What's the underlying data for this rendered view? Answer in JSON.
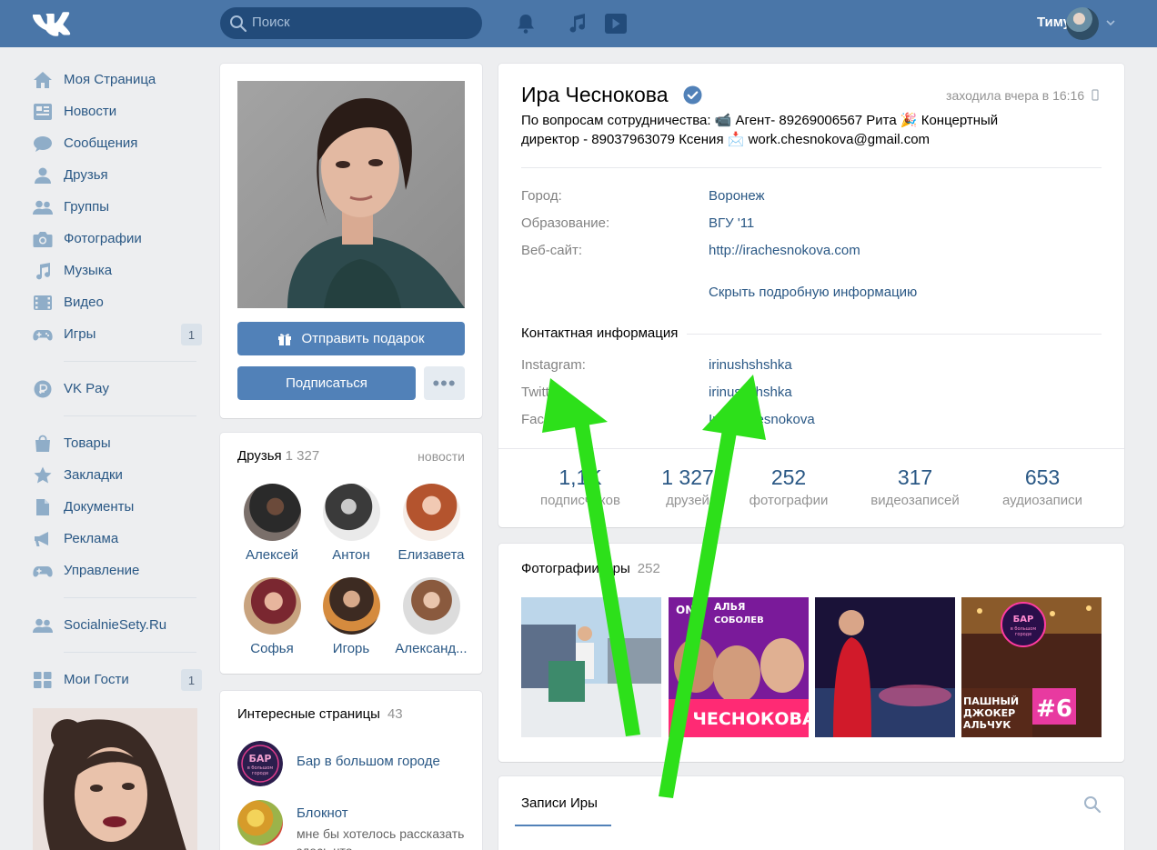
{
  "header": {
    "search_placeholder": "Поиск",
    "user_name": "Тимур",
    "colors": {
      "bar": "#4a76a8",
      "search_bg": "#224b7a",
      "link": "#2a5885",
      "button": "#5181b8",
      "arrow": "#2de01a"
    },
    "icons": [
      "vk-logo-icon",
      "search-icon",
      "bell-icon",
      "music-note-icon",
      "video-play-icon",
      "chevron-down-icon"
    ]
  },
  "nav": {
    "items": [
      {
        "label": "Моя Страница",
        "icon": "home-icon"
      },
      {
        "label": "Новости",
        "icon": "news-icon"
      },
      {
        "label": "Сообщения",
        "icon": "messages-icon"
      },
      {
        "label": "Друзья",
        "icon": "friend-icon"
      },
      {
        "label": "Группы",
        "icon": "groups-icon"
      },
      {
        "label": "Фотографии",
        "icon": "camera-icon"
      },
      {
        "label": "Музыка",
        "icon": "music-icon"
      },
      {
        "label": "Видео",
        "icon": "video-icon"
      },
      {
        "label": "Игры",
        "icon": "gamepad-icon",
        "count": "1"
      }
    ],
    "pay": {
      "label": "VK Pay",
      "icon": "vkpay-icon"
    },
    "items2": [
      {
        "label": "Товары",
        "icon": "bag-icon"
      },
      {
        "label": "Закладки",
        "icon": "star-icon"
      },
      {
        "label": "Документы",
        "icon": "document-icon"
      },
      {
        "label": "Реклама",
        "icon": "megaphone-icon"
      },
      {
        "label": "Управление",
        "icon": "gamepad-icon"
      }
    ],
    "community": {
      "label": "SocialnieSety.Ru",
      "icon": "groups-icon"
    },
    "guests": {
      "label": "Мои Гости",
      "icon": "apps-icon",
      "count": "1"
    }
  },
  "profile": {
    "send_gift": "Отправить подарок",
    "subscribe": "Подписаться",
    "more": "•••",
    "name": "Ира Чеснокова",
    "last_seen": "заходила вчера в 16:16",
    "status_line1": "По вопросам сотрудничества: 📹 Агент- 89269006567 Рита 🎉 Концертный",
    "status_line2": "директор - 89037963079 Ксения 📩 work.chesnokova@gmail.com",
    "details": [
      {
        "label": "Город:",
        "value": "Воронеж"
      },
      {
        "label": "Образование:",
        "value": "ВГУ '11"
      },
      {
        "label": "Веб-сайт:",
        "value": "http://irachesnokova.com"
      }
    ],
    "hide_details": "Скрыть подробную информацию",
    "contacts_title": "Контактная информация",
    "contacts": [
      {
        "label": "Instagram:",
        "value": "irinushshshka"
      },
      {
        "label": "Twitter:",
        "value": "irinushshshka"
      },
      {
        "label": "Facebook:",
        "value": "Irina Chesnokova"
      }
    ],
    "counters": [
      {
        "value": "1,1K",
        "label": "подписчиков"
      },
      {
        "value": "1 327",
        "label": "друзей"
      },
      {
        "value": "252",
        "label": "фотографии"
      },
      {
        "value": "317",
        "label": "видеозаписей"
      },
      {
        "value": "653",
        "label": "аудиозаписи"
      }
    ]
  },
  "friends": {
    "title": "Друзья",
    "count": "1 327",
    "link": "новости",
    "list": [
      {
        "name": "Алексей"
      },
      {
        "name": "Антон"
      },
      {
        "name": "Елизавета"
      },
      {
        "name": "Софья"
      },
      {
        "name": "Игорь"
      },
      {
        "name": "Александ..."
      }
    ]
  },
  "pages": {
    "title": "Интересные страницы",
    "count": "43",
    "list": [
      {
        "title": "Бар в большом городе",
        "subtitle": ""
      },
      {
        "title": "Блокнот",
        "subtitle": "мне бы хотелось рассказать здесь что..."
      }
    ],
    "logo_text": [
      "БАР",
      "в большом",
      "городе"
    ]
  },
  "photos": {
    "title": "Фотографии Иры",
    "count": "252",
    "thumb2_text": [
      "ONE",
      "АЛЬЯ",
      "СОБОЛЕВ",
      "Н ЧЕСНОКОВА"
    ],
    "thumb4_text": [
      "БАР",
      "в большом",
      "городе",
      "ПАШНЫЙ",
      "ДЖОКЕР",
      "АЛЬЧУК",
      "#6"
    ]
  },
  "wall": {
    "tab": "Записи Иры",
    "icon": "search-icon"
  }
}
